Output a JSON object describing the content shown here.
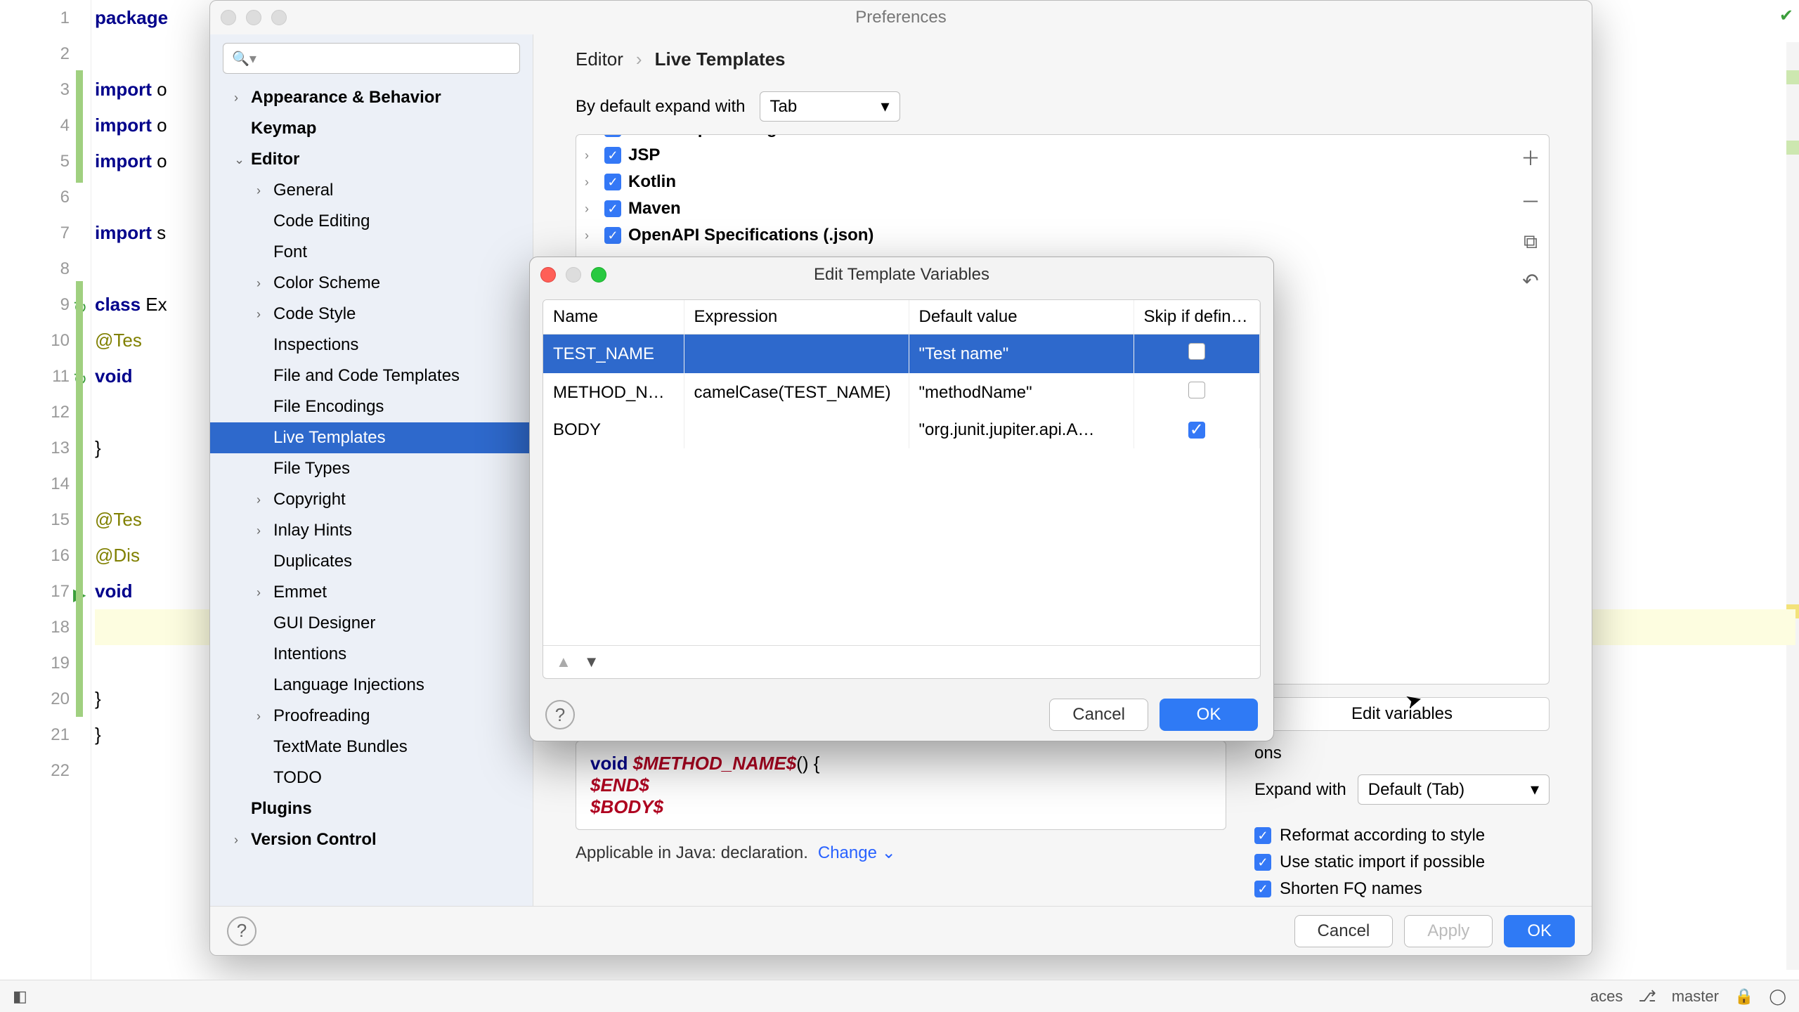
{
  "gutter": {
    "lines": [
      "1",
      "2",
      "3",
      "4",
      "5",
      "6",
      "7",
      "8",
      "9",
      "10",
      "11",
      "12",
      "13",
      "14",
      "15",
      "16",
      "17",
      "18",
      "19",
      "20",
      "21",
      "22"
    ]
  },
  "code": {
    "l1_kw": "package",
    "l3_kw": "import ",
    "l3_rest": "o",
    "l4_kw": "import ",
    "l4_rest": "o",
    "l5_kw": "import ",
    "l5_rest": "o",
    "l7_kw": "import ",
    "l7_rest": "s",
    "l9_kw": "class ",
    "l9_rest": "Ex",
    "l10_ann": "@Tes",
    "l11_kw": "void",
    "l13_cb": "}",
    "l15_ann": "@Tes",
    "l16_ann": "@Dis",
    "l17_kw": "void",
    "l20_cb": "}",
    "l21_cb": "}"
  },
  "prefs": {
    "title": "Preferences",
    "breadcrumb": {
      "section": "Editor",
      "page": "Live Templates"
    },
    "expand_label": "By default expand with",
    "expand_value": "Tab",
    "sidebar": {
      "items": [
        {
          "label": "Appearance & Behavior",
          "bold": true,
          "disclosure": true
        },
        {
          "label": "Keymap",
          "bold": true
        },
        {
          "label": "Editor",
          "bold": true,
          "disclosure": true,
          "open": true
        },
        {
          "label": "General",
          "indent": true,
          "disclosure": true
        },
        {
          "label": "Code Editing",
          "indent": true
        },
        {
          "label": "Font",
          "indent": true
        },
        {
          "label": "Color Scheme",
          "indent": true,
          "disclosure": true
        },
        {
          "label": "Code Style",
          "indent": true,
          "disclosure": true
        },
        {
          "label": "Inspections",
          "indent": true
        },
        {
          "label": "File and Code Templates",
          "indent": true
        },
        {
          "label": "File Encodings",
          "indent": true
        },
        {
          "label": "Live Templates",
          "indent": true,
          "selected": true
        },
        {
          "label": "File Types",
          "indent": true
        },
        {
          "label": "Copyright",
          "indent": true,
          "disclosure": true
        },
        {
          "label": "Inlay Hints",
          "indent": true,
          "disclosure": true
        },
        {
          "label": "Duplicates",
          "indent": true
        },
        {
          "label": "Emmet",
          "indent": true,
          "disclosure": true
        },
        {
          "label": "GUI Designer",
          "indent": true
        },
        {
          "label": "Intentions",
          "indent": true
        },
        {
          "label": "Language Injections",
          "indent": true
        },
        {
          "label": "Proofreading",
          "indent": true,
          "disclosure": true
        },
        {
          "label": "TextMate Bundles",
          "indent": true
        },
        {
          "label": "TODO",
          "indent": true
        },
        {
          "label": "Plugins",
          "bold": true
        },
        {
          "label": "Version Control",
          "bold": true,
          "disclosure": true
        }
      ]
    },
    "groups": [
      {
        "label": "JavaScript Testing",
        "checked": true,
        "cut": true
      },
      {
        "label": "JSP",
        "checked": true
      },
      {
        "label": "Kotlin",
        "checked": true
      },
      {
        "label": "Maven",
        "checked": true
      },
      {
        "label": "OpenAPI Specifications (.json)",
        "checked": true,
        "cut_bottom": true
      }
    ],
    "template_text": {
      "l1_kw": "void ",
      "l1_var": "$METHOD_NAME$",
      "l1_rest": "() {",
      "l2_var": "$END$",
      "l3_var": "$BODY$"
    },
    "edit_vars_label": "Edit variables",
    "options_header": "ons",
    "opt1": "Reformat according to style",
    "opt2": "Use static import if possible",
    "opt3": "Shorten FQ names",
    "expand_with_label": "Expand with",
    "expand_with_value": "Default (Tab)",
    "applicable_text": "Applicable in Java: declaration.",
    "change_label": "Change",
    "footer": {
      "cancel": "Cancel",
      "apply": "Apply",
      "ok": "OK"
    }
  },
  "etv": {
    "title": "Edit Template Variables",
    "headers": {
      "name": "Name",
      "expr": "Expression",
      "def": "Default value",
      "skip": "Skip if defin…"
    },
    "rows": [
      {
        "name": "TEST_NAME",
        "expr": "",
        "def": "\"Test name\"",
        "skip": false,
        "selected": true
      },
      {
        "name": "METHOD_N…",
        "expr": "camelCase(TEST_NAME)",
        "def": "\"methodName\"",
        "skip": false
      },
      {
        "name": "BODY",
        "expr": "",
        "def": "\"org.junit.jupiter.api.A…",
        "skip": true
      }
    ],
    "footer": {
      "cancel": "Cancel",
      "ok": "OK"
    }
  },
  "status": {
    "spaces": "aces",
    "branch": "master",
    "lock": "🔒"
  }
}
